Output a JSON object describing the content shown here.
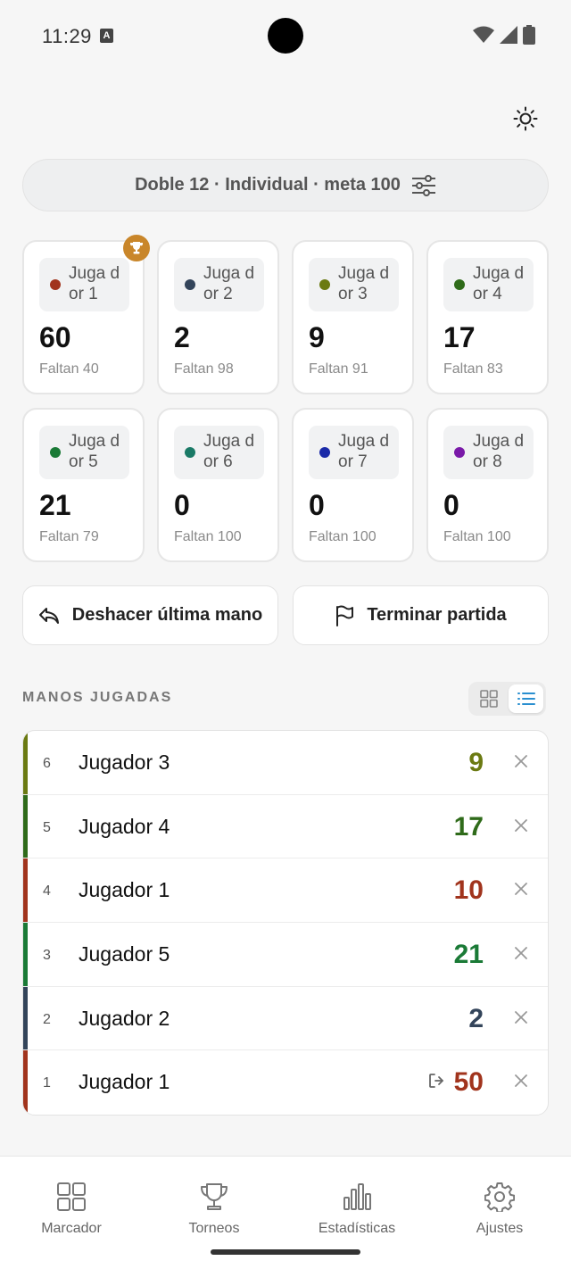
{
  "status_bar": {
    "time": "11:29",
    "notification_icon": "A"
  },
  "config": {
    "summary": "Doble 12 · Individual · meta 100",
    "icon": "sliders-icon"
  },
  "players": [
    {
      "name": "Juga dor 1",
      "color": "#a1341d",
      "score": "60",
      "remaining": "Faltan 40",
      "leader": true
    },
    {
      "name": "Juga dor 2",
      "color": "#33445a",
      "score": "2",
      "remaining": "Faltan 98"
    },
    {
      "name": "Juga dor 3",
      "color": "#6b7a12",
      "score": "9",
      "remaining": "Faltan 91"
    },
    {
      "name": "Juga dor 4",
      "color": "#2f6b1a",
      "score": "17",
      "remaining": "Faltan 83"
    },
    {
      "name": "Juga dor 5",
      "color": "#1a7a36",
      "score": "21",
      "remaining": "Faltan 79"
    },
    {
      "name": "Juga dor 6",
      "color": "#1a7a66",
      "score": "0",
      "remaining": "Faltan 100"
    },
    {
      "name": "Juga dor 7",
      "color": "#1a2aa8",
      "score": "0",
      "remaining": "Faltan 100"
    },
    {
      "name": "Juga dor 8",
      "color": "#7a1aa8",
      "score": "0",
      "remaining": "Faltan 100"
    }
  ],
  "actions": {
    "undo": "Deshacer última mano",
    "finish": "Terminar partida"
  },
  "hands_section": {
    "title": "MANOS JUGADAS"
  },
  "hands": [
    {
      "num": "6",
      "player": "Jugador 3",
      "score": "9",
      "color": "#6b7a12"
    },
    {
      "num": "5",
      "player": "Jugador 4",
      "score": "17",
      "color": "#2f6b1a"
    },
    {
      "num": "4",
      "player": "Jugador 1",
      "score": "10",
      "color": "#a1341d"
    },
    {
      "num": "3",
      "player": "Jugador 5",
      "score": "21",
      "color": "#1a7a36"
    },
    {
      "num": "2",
      "player": "Jugador 2",
      "score": "2",
      "color": "#33445a"
    },
    {
      "num": "1",
      "player": "Jugador 1",
      "score": "50",
      "color": "#a1341d",
      "closed": true
    }
  ],
  "nav": [
    {
      "label": "Marcador",
      "icon": "grid-icon"
    },
    {
      "label": "Torneos",
      "icon": "trophy-icon"
    },
    {
      "label": "Estadísticas",
      "icon": "bar-chart-icon"
    },
    {
      "label": "Ajustes",
      "icon": "gear-icon"
    }
  ]
}
